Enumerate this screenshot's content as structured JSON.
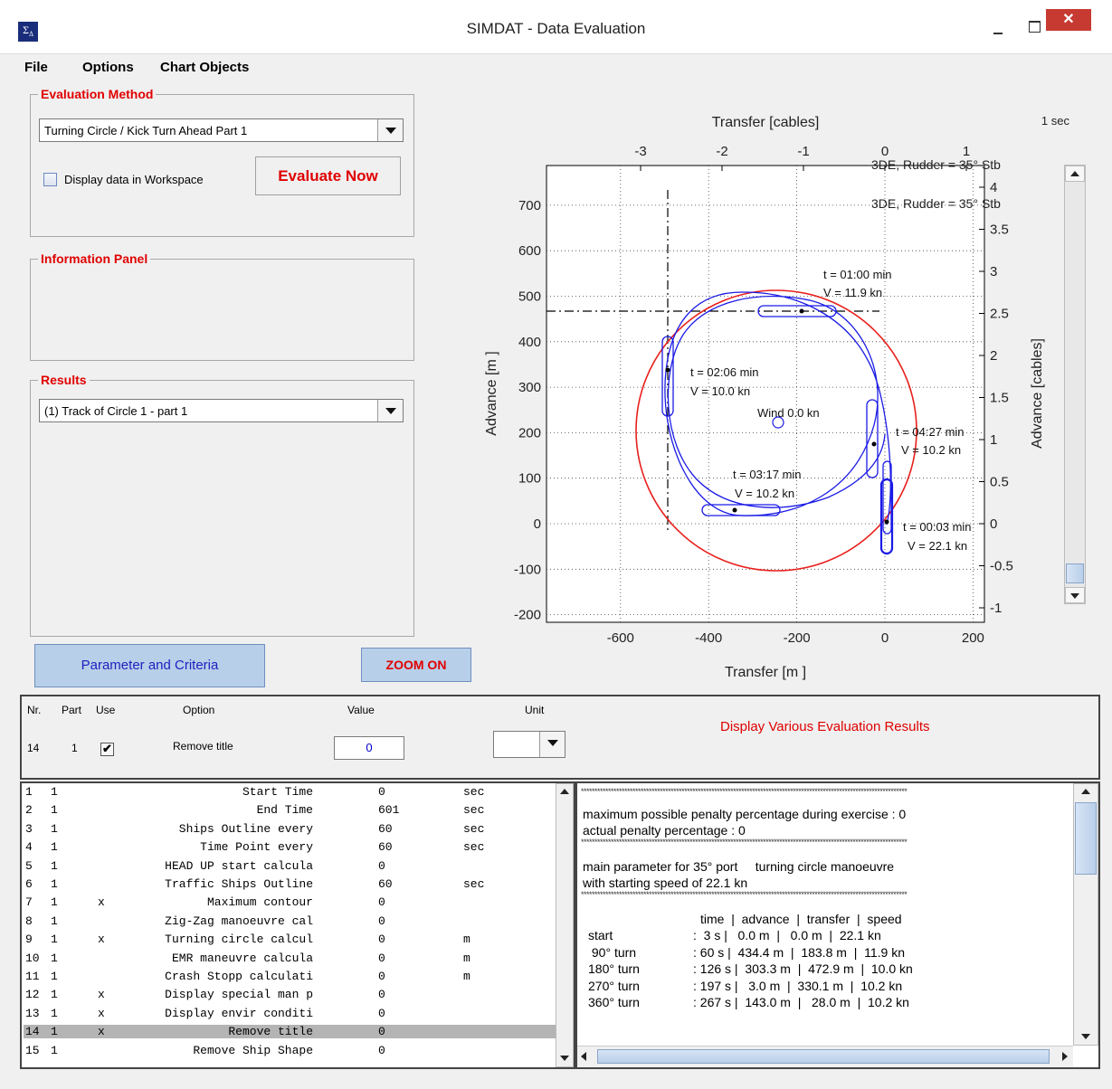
{
  "window": {
    "title": "SIMDAT - Data Evaluation",
    "icon": "sigma-delta-icon",
    "close": "✕"
  },
  "menu": [
    "File",
    "Options",
    "Chart Objects"
  ],
  "evaluation": {
    "legend": "Evaluation Method",
    "method": "Turning Circle / Kick Turn Ahead Part 1",
    "display_label": "Display data in Workspace",
    "display_checked": false,
    "evaluate_button": "Evaluate Now"
  },
  "info": {
    "legend": "Information Panel"
  },
  "results": {
    "legend": "Results",
    "selected": "(1) Track of Circle 1 - part 1"
  },
  "buttons": {
    "parameter": "Parameter and Criteria",
    "zoom": "ZOOM ON"
  },
  "chart": {
    "top_title": "Transfer [cables]",
    "bottom_title": "Transfer [m    ]",
    "left_title": "Advance [m    ]",
    "right_title": "Advance [cables]",
    "time_step": "1 sec",
    "legend_1": "3DE, Rudder = 35° Stb",
    "legend_2": "3DE, Rudder = 35° Stb",
    "wind_label": "Wind 0.0 kn",
    "marks": [
      {
        "t": "t = 01:00 min",
        "v": "V = 11.9 kn"
      },
      {
        "t": "t = 02:06 min",
        "v": "V = 10.0 kn"
      },
      {
        "t": "t = 04:27 min",
        "v": "V = 10.2 kn"
      },
      {
        "t": "t = 03:17 min",
        "v": "V = 10.2 kn"
      },
      {
        "t": "t = 00:03 min",
        "v": "V = 22.1 kn"
      }
    ],
    "x_ticks_m": [
      "-600",
      "-400",
      "-200",
      "0",
      "200"
    ],
    "y_ticks_m": [
      "700",
      "600",
      "500",
      "400",
      "300",
      "200",
      "100",
      "0",
      "-100",
      "-200"
    ],
    "x_ticks_cables": [
      "-3",
      "-2",
      "-1",
      "0",
      "1"
    ],
    "y_ticks_cables": [
      "4",
      "3.5",
      "3",
      "2.5",
      "2",
      "1.5",
      "1",
      "0.5",
      "0",
      "-0.5",
      "-1"
    ],
    "colors": {
      "circle_max": "#e8201c",
      "track": "#1a1ae6"
    }
  },
  "chart_data": {
    "type": "scatter",
    "xlabel": "Transfer [m    ]",
    "ylabel": "Advance [m    ]",
    "xlim": [
      -720,
      210
    ],
    "ylim": [
      -220,
      780
    ],
    "grid": true,
    "series": [
      {
        "name": "3DE, Rudder = 35° Stb",
        "points": [
          [
            0,
            0
          ],
          [
            183.8,
            434.4
          ],
          [
            472.9,
            303.3
          ],
          [
            330.1,
            3.0
          ]
        ]
      }
    ],
    "annotations": [
      {
        "label": "t = 00:03 min",
        "x": 0,
        "y": 0
      },
      {
        "label": "t = 01:00 min",
        "x": -200,
        "y": 460
      },
      {
        "label": "t = 02:06 min",
        "x": -470,
        "y": 330
      },
      {
        "label": "t = 03:17 min",
        "x": -340,
        "y": 25
      },
      {
        "label": "t = 04:27 min",
        "x": -30,
        "y": 175
      }
    ]
  },
  "option_header": {
    "cols": [
      "Nr.",
      "Part",
      "Use",
      "Option",
      "Value",
      "Unit"
    ],
    "nr": "14",
    "part": "1",
    "use_checked": true,
    "option": "Remove title",
    "value": "0",
    "unit": "",
    "display_results": "Display Various Evaluation Results"
  },
  "params": [
    {
      "nr": "1",
      "part": "1",
      "use": "",
      "name": "Start Time",
      "value": "0",
      "unit": "sec"
    },
    {
      "nr": "2",
      "part": "1",
      "use": "",
      "name": "End Time",
      "value": "601",
      "unit": "sec"
    },
    {
      "nr": "3",
      "part": "1",
      "use": "",
      "name": "Ships Outline every",
      "value": "60",
      "unit": "sec"
    },
    {
      "nr": "4",
      "part": "1",
      "use": "",
      "name": "Time Point every",
      "value": "60",
      "unit": "sec"
    },
    {
      "nr": "5",
      "part": "1",
      "use": "",
      "name": "HEAD UP start calcula",
      "value": "0",
      "unit": ""
    },
    {
      "nr": "6",
      "part": "1",
      "use": "",
      "name": "Traffic Ships Outline",
      "value": "60",
      "unit": "sec"
    },
    {
      "nr": "7",
      "part": "1",
      "use": "x",
      "name": "Maximum contour",
      "value": "0",
      "unit": ""
    },
    {
      "nr": "8",
      "part": "1",
      "use": "",
      "name": "Zig-Zag manoeuvre cal",
      "value": "0",
      "unit": ""
    },
    {
      "nr": "9",
      "part": "1",
      "use": "x",
      "name": "Turning circle calcul",
      "value": "0",
      "unit": "m"
    },
    {
      "nr": "10",
      "part": "1",
      "use": "",
      "name": "EMR maneuvre calcula",
      "value": "0",
      "unit": "m"
    },
    {
      "nr": "11",
      "part": "1",
      "use": "",
      "name": "Crash Stopp calculati",
      "value": "0",
      "unit": "m"
    },
    {
      "nr": "12",
      "part": "1",
      "use": "x",
      "name": "Display special man p",
      "value": "0",
      "unit": ""
    },
    {
      "nr": "13",
      "part": "1",
      "use": "x",
      "name": "Display envir conditi",
      "value": "0",
      "unit": ""
    },
    {
      "nr": "14",
      "part": "1",
      "use": "x",
      "name": "Remove title",
      "value": "0",
      "unit": ""
    },
    {
      "nr": "15",
      "part": "1",
      "use": "",
      "name": "Remove Ship Shape",
      "value": "0",
      "unit": ""
    }
  ],
  "selected_param_index": 13,
  "results_text": {
    "stars": "************************************************************************************************************************",
    "penalty_max": "maximum possible penalty percentage during exercise : 0",
    "penalty_actual": "actual penalty percentage : 0",
    "main_param": "main parameter for 35° port     turning circle manoeuvre",
    "start_speed": "with starting speed of 22.1 kn",
    "table_header": "time  |  advance  |  transfer  |  speed",
    "rows": [
      {
        "label": "start",
        "values": ":  3 s |   0.0 m  |   0.0 m  |  22.1 kn"
      },
      {
        "label": " 90° turn",
        "values": ": 60 s |  434.4 m  |  183.8 m  |  11.9 kn"
      },
      {
        "label": "180° turn",
        "values": ": 126 s |  303.3 m  |  472.9 m  |  10.0 kn"
      },
      {
        "label": "270° turn",
        "values": ": 197 s |   3.0 m  |  330.1 m  |  10.2 kn"
      },
      {
        "label": "360° turn",
        "values": ": 267 s |  143.0 m  |   28.0 m  |  10.2 kn"
      }
    ]
  }
}
